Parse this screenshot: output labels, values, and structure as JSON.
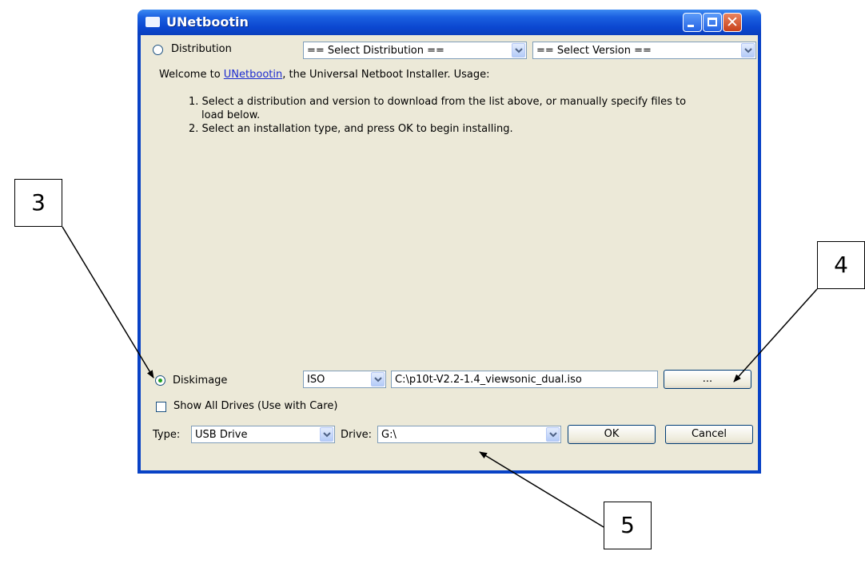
{
  "window": {
    "title": "UNetbootin"
  },
  "distribution": {
    "radio_label": "Distribution",
    "distribution_combo": "== Select Distribution ==",
    "version_combo": "== Select Version =="
  },
  "welcome": {
    "prefix": "Welcome to ",
    "link": "UNetbootin",
    "suffix": ", the Universal Netboot Installer. Usage:",
    "step1_line1": "1. Select a distribution and version to download from the list above, or manually specify files to",
    "step1_line2": "load below.",
    "step2": "2. Select an installation type, and press OK to begin installing."
  },
  "diskimage": {
    "radio_label": "Diskimage",
    "selected": true,
    "format_combo": "ISO",
    "path": "C:\\p10t-V2.2-1.4_viewsonic_dual.iso",
    "browse_label": "..."
  },
  "show_all_drives": {
    "label": "Show All Drives (Use with Care)",
    "checked": false
  },
  "bottom": {
    "type_label": "Type:",
    "type_value": "USB Drive",
    "drive_label": "Drive:",
    "drive_value": "G:\\",
    "ok_label": "OK",
    "cancel_label": "Cancel"
  },
  "callouts": {
    "c3": "3",
    "c4": "4",
    "c5": "5"
  },
  "colors": {
    "titlebar": "#0b47d0",
    "client": "#ece9d8",
    "link": "#1c2bd0",
    "radio_dot": "#21a121"
  }
}
